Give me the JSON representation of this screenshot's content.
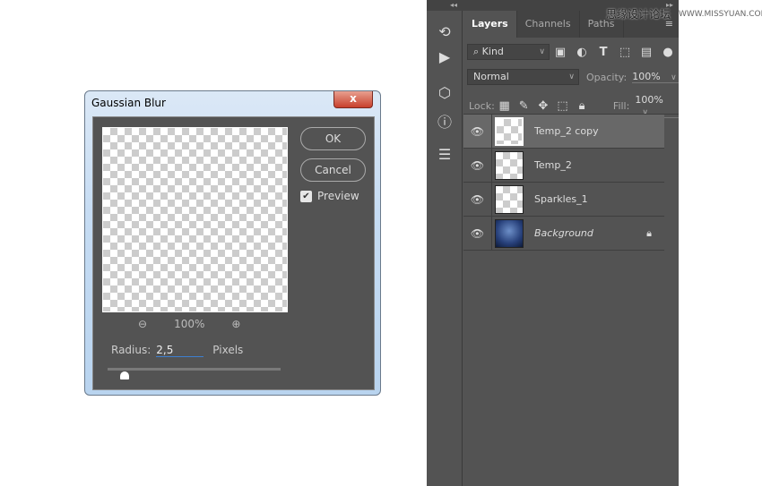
{
  "dialog": {
    "title": "Gaussian Blur",
    "close": "x",
    "ok": "OK",
    "cancel": "Cancel",
    "preview_label": "Preview",
    "preview_checked": true,
    "zoom": "100%",
    "radius_label": "Radius:",
    "radius_value": "2,5",
    "radius_unit": "Pixels",
    "slider_fraction": 0.1
  },
  "panel": {
    "tabs": [
      "Layers",
      "Channels",
      "Paths"
    ],
    "filter": "Kind",
    "blend_mode": "Normal",
    "opacity_label": "Opacity:",
    "opacity": "100%",
    "lock_label": "Lock:",
    "fill_label": "Fill:",
    "fill": "100%",
    "layers": [
      {
        "name": "Temp_2 copy",
        "selected": true
      },
      {
        "name": "Temp_2"
      },
      {
        "name": "Sparkles_1"
      },
      {
        "name": "Background",
        "italic": true,
        "locked": true
      }
    ]
  },
  "watermark": {
    "cn": "思缘设计论坛",
    "url": "WWW.MISSYUAN.COM"
  }
}
